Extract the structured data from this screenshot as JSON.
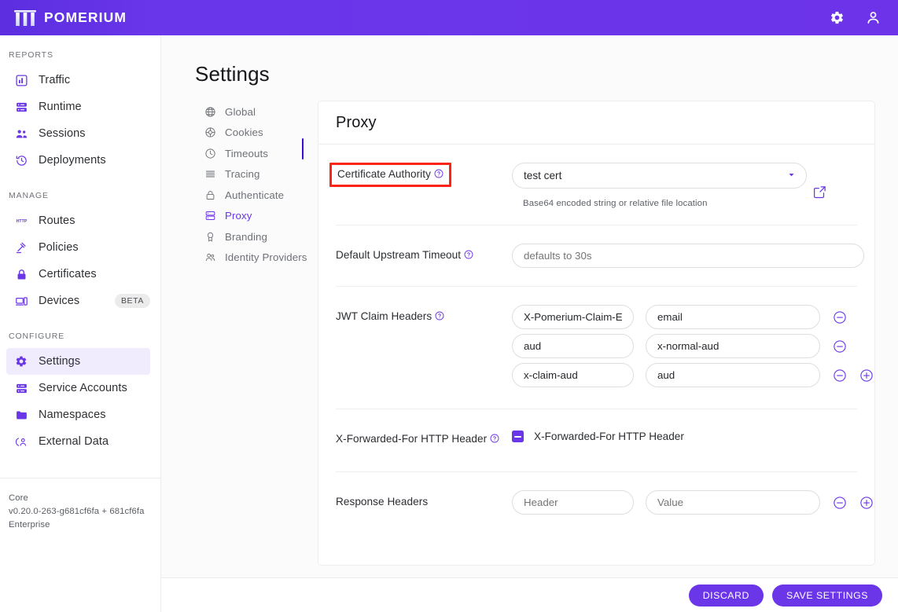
{
  "brand": {
    "name": "POMERIUM",
    "logo_icon": "pomerium-logo-icon"
  },
  "topbar": {
    "settings_icon": "gear-icon",
    "account_icon": "user-account-icon",
    "background_color": "#6b35e8"
  },
  "sidebar": {
    "sections": [
      {
        "label": "REPORTS",
        "items": [
          {
            "label": "Traffic",
            "icon": "traffic-chart-icon",
            "active": false
          },
          {
            "label": "Runtime",
            "icon": "runtime-server-icon",
            "active": false
          },
          {
            "label": "Sessions",
            "icon": "sessions-people-icon",
            "active": false
          },
          {
            "label": "Deployments",
            "icon": "deployments-history-icon",
            "active": false
          }
        ]
      },
      {
        "label": "MANAGE",
        "items": [
          {
            "label": "Routes",
            "icon": "http-routes-icon",
            "active": false
          },
          {
            "label": "Policies",
            "icon": "policies-gavel-icon",
            "active": false
          },
          {
            "label": "Certificates",
            "icon": "certificates-lock-icon",
            "active": false
          },
          {
            "label": "Devices",
            "icon": "devices-laptop-icon",
            "active": false,
            "badge": "BETA"
          }
        ]
      },
      {
        "label": "CONFIGURE",
        "items": [
          {
            "label": "Settings",
            "icon": "settings-gear-icon",
            "active": true
          },
          {
            "label": "Service Accounts",
            "icon": "service-accounts-icon",
            "active": false
          },
          {
            "label": "Namespaces",
            "icon": "namespaces-folder-icon",
            "active": false
          },
          {
            "label": "External Data",
            "icon": "external-data-icon",
            "active": false
          }
        ]
      }
    ],
    "footer": {
      "edition": "Core",
      "version": "v0.20.0-263-g681cf6fa + 681cf6fa",
      "tier": "Enterprise"
    }
  },
  "page": {
    "title": "Settings"
  },
  "subnav": {
    "items": [
      {
        "label": "Global",
        "icon": "globe-icon",
        "active": false
      },
      {
        "label": "Cookies",
        "icon": "cookie-icon",
        "active": false
      },
      {
        "label": "Timeouts",
        "icon": "clock-icon",
        "active": false
      },
      {
        "label": "Tracing",
        "icon": "tracing-lines-icon",
        "active": false
      },
      {
        "label": "Authenticate",
        "icon": "lock-icon",
        "active": false
      },
      {
        "label": "Proxy",
        "icon": "proxy-server-icon",
        "active": true
      },
      {
        "label": "Branding",
        "icon": "branding-ribbon-icon",
        "active": false
      },
      {
        "label": "Identity Providers",
        "icon": "identity-providers-icon",
        "active": false
      }
    ],
    "active_color": "#6b35e8",
    "marker_color": "#3b0fd0"
  },
  "card": {
    "title": "Proxy",
    "certificate_authority": {
      "label": "Certificate Authority",
      "help_icon": "help-circle-icon",
      "select_value": "test cert",
      "caret_icon": "chevron-down-icon",
      "helper_text": "Base64 encoded string or relative file location",
      "external_link_icon": "open-in-new-icon",
      "highlight_color": "#fd2416",
      "highlighted": true
    },
    "default_upstream_timeout": {
      "label": "Default Upstream Timeout",
      "help_icon": "help-circle-icon",
      "placeholder": "defaults to 30s",
      "value": ""
    },
    "jwt_claim_headers": {
      "label": "JWT Claim Headers",
      "help_icon": "help-circle-icon",
      "rows": [
        {
          "key": "X-Pomerium-Claim-En",
          "value": "email",
          "remove_icon": "minus-circle-icon",
          "add_icon": null
        },
        {
          "key": "aud",
          "value": "x-normal-aud",
          "remove_icon": "minus-circle-icon",
          "add_icon": null
        },
        {
          "key": "x-claim-aud",
          "value": "aud",
          "remove_icon": "minus-circle-icon",
          "add_icon": "plus-circle-icon"
        }
      ]
    },
    "x_forwarded_for": {
      "label": "X-Forwarded-For HTTP Header",
      "help_icon": "help-circle-icon",
      "checkbox_label": "X-Forwarded-For HTTP Header",
      "checkbox_state": "indeterminate"
    },
    "response_headers": {
      "label": "Response Headers",
      "rows": [
        {
          "key": "",
          "key_placeholder": "Header",
          "value": "",
          "value_placeholder": "Value",
          "remove_icon": "minus-circle-icon",
          "add_icon": "plus-circle-icon"
        }
      ]
    }
  },
  "footer_actions": {
    "discard_label": "DISCARD",
    "save_label": "SAVE SETTINGS",
    "button_color": "#6b35e8"
  }
}
